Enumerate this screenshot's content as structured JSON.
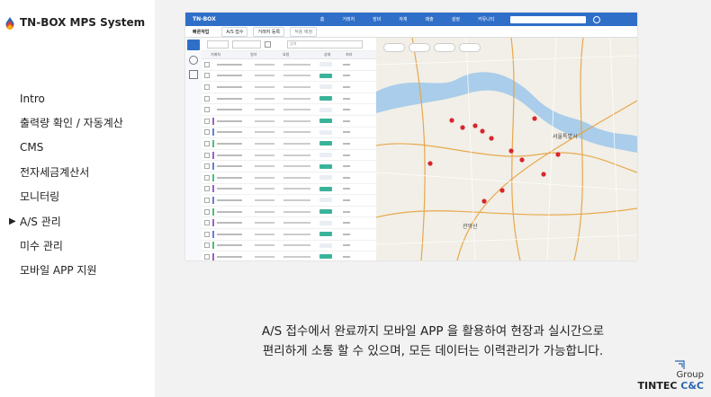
{
  "sidebar": {
    "app_title": "TN-BOX MPS System",
    "menu": [
      {
        "label": "Intro"
      },
      {
        "label": "출력량 확인 / 자동계산"
      },
      {
        "label": "CMS"
      },
      {
        "label": "전자세금계산서"
      },
      {
        "label": "모니터링"
      },
      {
        "label": "A/S 관리",
        "active": true
      },
      {
        "label": "미수 관리"
      },
      {
        "label": "모바일 APP 지원"
      }
    ],
    "active_marker": "▶"
  },
  "screenshot": {
    "brand": "TN-BOX",
    "tabs": [
      "홈",
      "거래처",
      "장비",
      "자재",
      "매출",
      "설정",
      "커뮤니티"
    ],
    "subnav_title": "빠른작업",
    "subnav_tabs": [
      "A/S 접수",
      "거래처 등록",
      "적용 예정"
    ],
    "search_placeholder": "검색",
    "table_headers": [
      "",
      "거래처",
      "일자",
      "요청",
      "상태",
      "처리"
    ],
    "row_count": 19,
    "map_labels": [
      "서울특별시",
      "관악산"
    ]
  },
  "caption": {
    "line1": "A/S 접수에서 완료까지 모바일 APP 을 활용하여 현장과 실시간으로",
    "line2": "편리하게 소통 할  수 있으며, 모든 데이터는 이력관리가 가능합니다."
  },
  "footer": {
    "group": "Group",
    "brand_main": "TINTEC ",
    "brand_sub": "C&C"
  },
  "colors": {
    "accent": "#2f6fc8",
    "map_water": "#a9cdea",
    "marker_red": "#d8262e"
  }
}
